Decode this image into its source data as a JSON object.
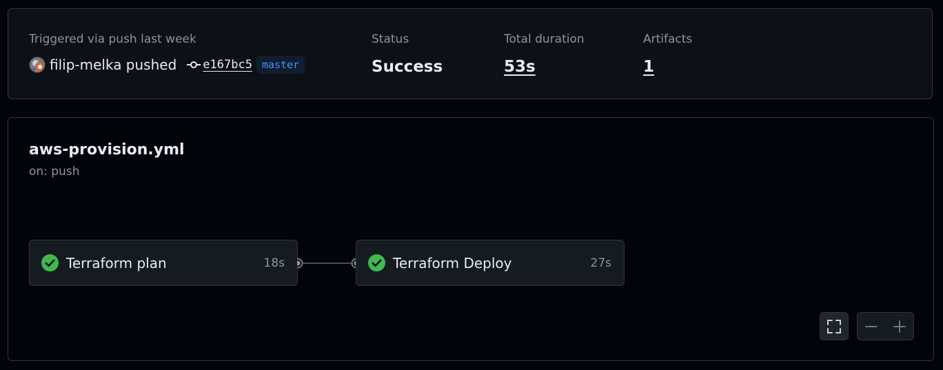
{
  "summary": {
    "trigger_label": "Triggered via push last week",
    "actor_text": "filip-melka pushed",
    "commit_sha": "e167bc5",
    "branch": "master",
    "status_label": "Status",
    "status_value": "Success",
    "duration_label": "Total duration",
    "duration_value": "53s",
    "artifacts_label": "Artifacts",
    "artifacts_value": "1"
  },
  "workflow": {
    "file_name": "aws-provision.yml",
    "trigger": "on: push",
    "jobs": [
      {
        "name": "Terraform plan",
        "duration": "18s",
        "status": "success"
      },
      {
        "name": "Terraform Deploy",
        "duration": "27s",
        "status": "success"
      }
    ]
  },
  "controls": {
    "fullscreen_icon": "fullscreen-icon",
    "zoom_out_icon": "minus-icon",
    "zoom_in_icon": "plus-icon"
  },
  "colors": {
    "success": "#3fb950",
    "branch": "#4493f8"
  }
}
